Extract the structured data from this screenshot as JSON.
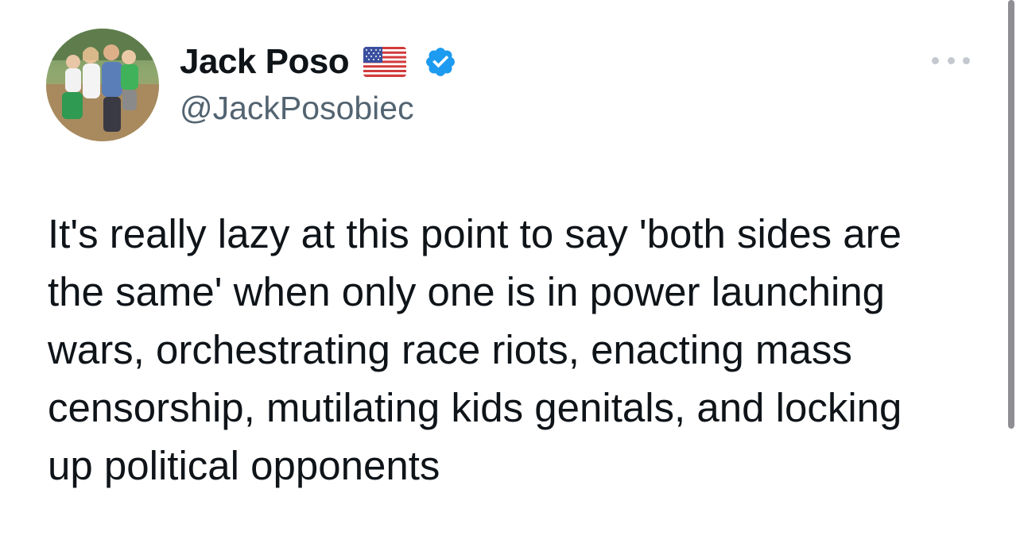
{
  "author": {
    "display_name": "Jack Poso",
    "handle": "@JackPosobiec",
    "flag_icon": "us-flag-icon",
    "verified_icon": "verified-badge-icon",
    "verified_color": "#1d9bf0",
    "avatar_icon": "profile-photo"
  },
  "tweet": {
    "text": "It's really lazy at this point to say 'both sides are\nthe same' when only one is in power launching\nwars, orchestrating race riots, enacting mass\ncensorship, mutilating kids genitals, and locking\nup political opponents"
  },
  "actions": {
    "more_icon": "more-options-icon"
  },
  "colors": {
    "text": "#0f1419",
    "secondary_text": "#536471",
    "background": "#ffffff"
  }
}
